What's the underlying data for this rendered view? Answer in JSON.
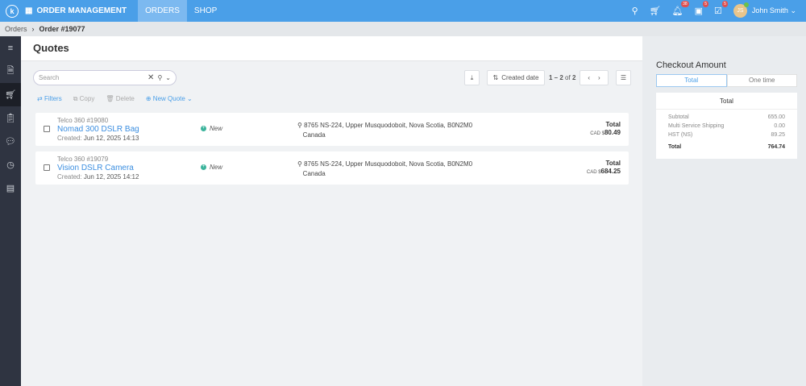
{
  "topbar": {
    "app_title": "ORDER MANAGEMENT",
    "nav": [
      {
        "label": "ORDERS"
      },
      {
        "label": "SHOP"
      }
    ],
    "badges": {
      "notifications": "38",
      "tasks": "5",
      "checklist": "5"
    },
    "user": {
      "initials": "JS",
      "name": "John Smith"
    }
  },
  "breadcrumb": {
    "parent": "Orders",
    "current": "Order #19077"
  },
  "page": {
    "title": "Quotes"
  },
  "search": {
    "placeholder": "Search"
  },
  "toolbar": {
    "sort_label": "Created date",
    "pagination": {
      "range": "1 – 2",
      "of": "of",
      "total": "2"
    }
  },
  "actions": {
    "filters": "Filters",
    "copy": "Copy",
    "delete": "Delete",
    "new_quote": "New Quote"
  },
  "quotes": [
    {
      "account": "Telco 360 #19080",
      "name": "Nomad 300 DSLR Bag",
      "created_label": "Created:",
      "created": "Jun 12, 2025 14:13",
      "status": "New",
      "address1": "8765 NS-224, Upper Musquodoboit, Nova Scotia, B0N2M0",
      "address2": "Canada",
      "total_label": "Total",
      "currency": "CAD $",
      "amount": "80.49"
    },
    {
      "account": "Telco 360 #19079",
      "name": "Vision DSLR Camera",
      "created_label": "Created:",
      "created": "Jun 12, 2025 14:12",
      "status": "New",
      "address1": "8765 NS-224, Upper Musquodoboit, Nova Scotia, B0N2M0",
      "address2": "Canada",
      "total_label": "Total",
      "currency": "CAD $",
      "amount": "684.25"
    }
  ],
  "checkout": {
    "title": "Checkout Amount",
    "tabs": [
      "Total",
      "One time"
    ],
    "box_title": "Total",
    "lines": [
      {
        "label": "Subtotal",
        "value": "655.00"
      },
      {
        "label": "Multi Service Shipping",
        "value": "0.00"
      },
      {
        "label": "HST (NS)",
        "value": "89.25"
      }
    ],
    "total_label": "Total",
    "total_value": "764.74"
  }
}
